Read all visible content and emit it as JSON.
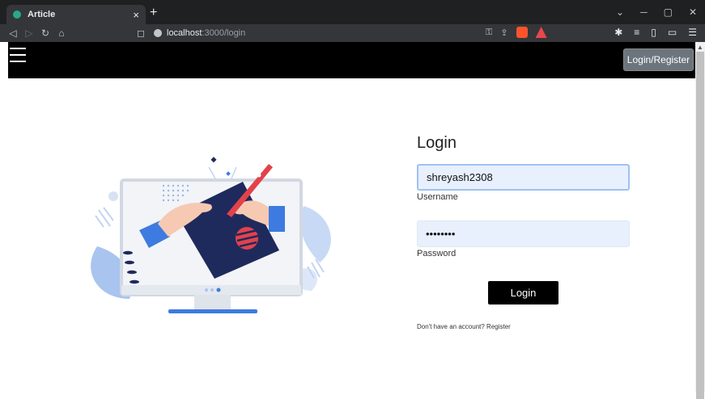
{
  "browser": {
    "tab_title": "Article",
    "tab_close": "×",
    "new_tab": "+",
    "url_host": "localhost",
    "url_path": ":3000/login"
  },
  "navbar": {
    "login_register_label": "Login/Register"
  },
  "login": {
    "title": "Login",
    "username_value": "shreyash2308",
    "username_label": "Username",
    "password_value": "password",
    "password_label": "Password",
    "submit_label": "Login",
    "register_prompt": "Don't have an account?",
    "register_link": "Register"
  },
  "colors": {
    "navbar_bg": "#000000",
    "input_bg": "#e8f0fe",
    "button_bg": "#000000",
    "illustration_navy": "#1f2a5c",
    "illustration_blue": "#3d7be0",
    "illustration_red": "#e2424b"
  }
}
